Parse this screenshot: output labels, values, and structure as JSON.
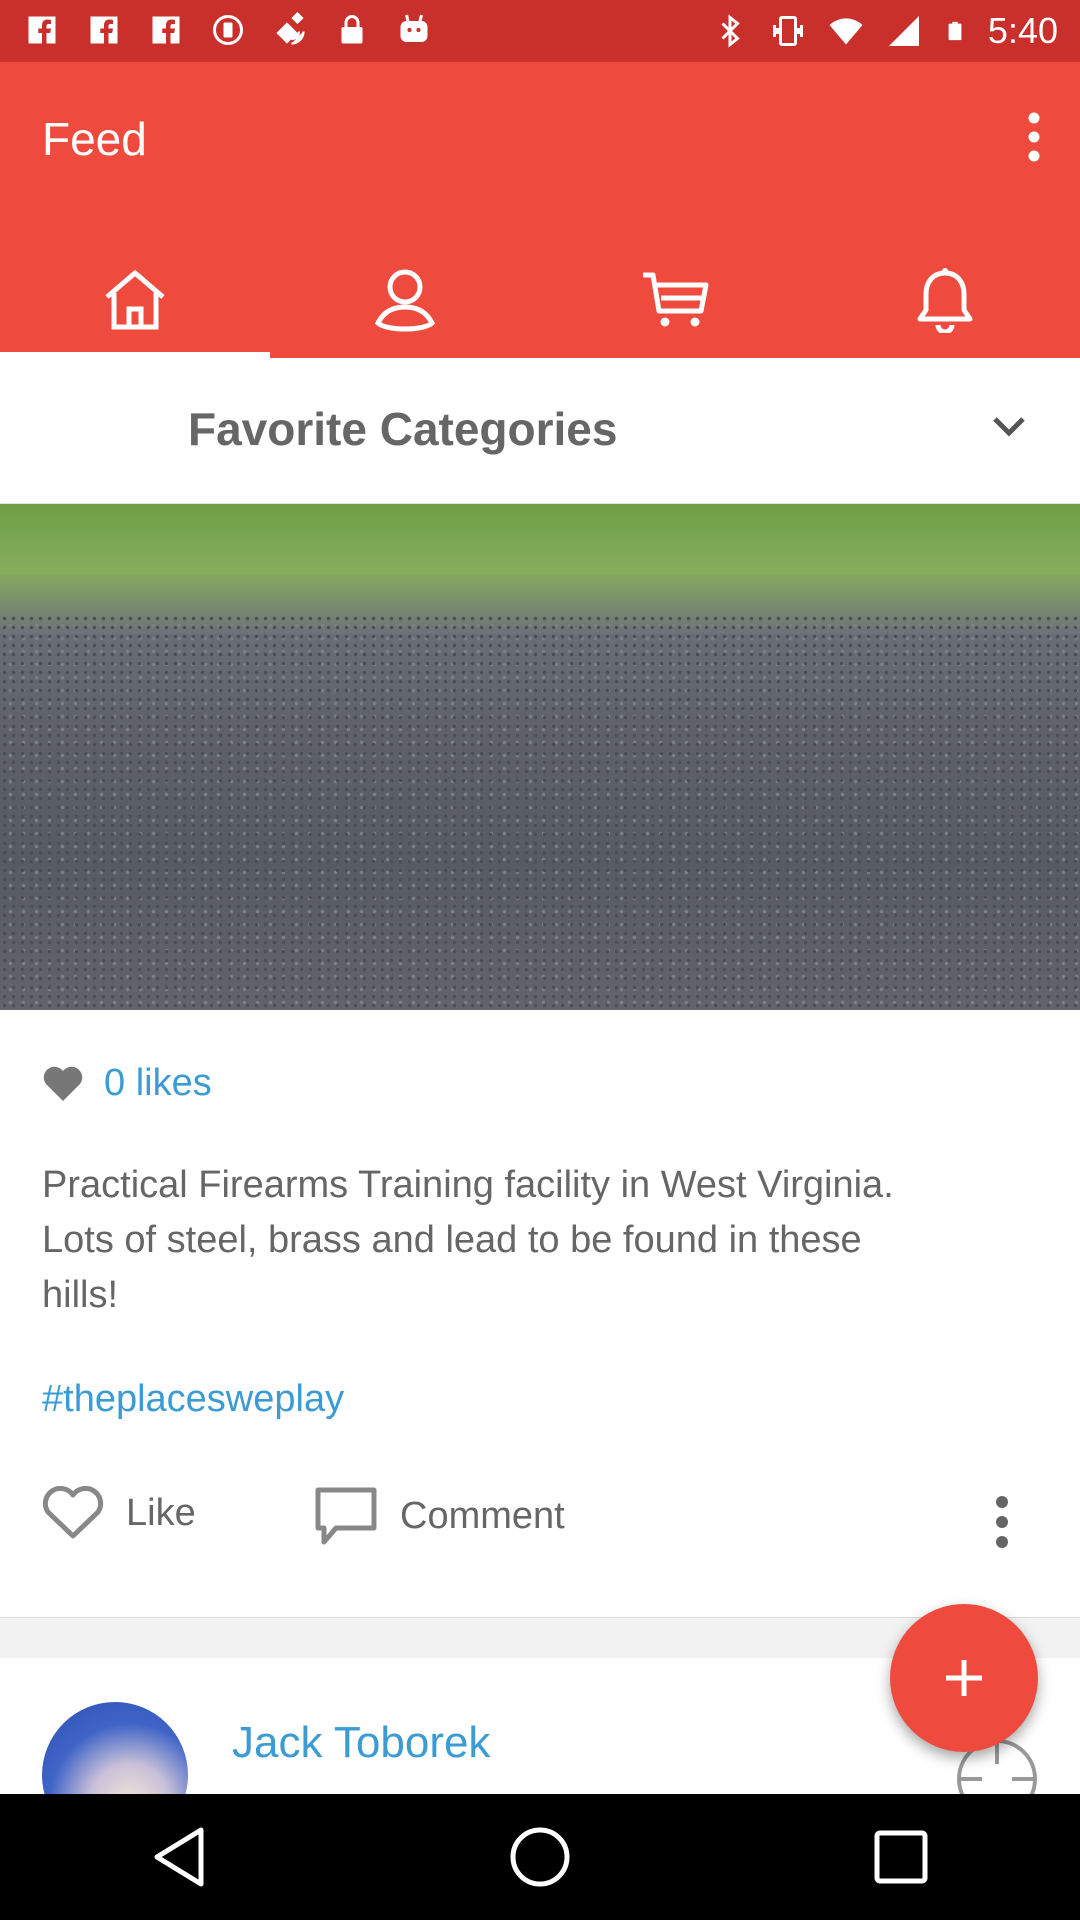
{
  "status_bar": {
    "time": "5:40",
    "left_icons": [
      "facebook-icon",
      "facebook-icon",
      "facebook-icon",
      "record-icon",
      "satellite-icon",
      "lock-icon",
      "android-icon"
    ],
    "right_icons": [
      "bluetooth-icon",
      "vibrate-icon",
      "wifi-icon",
      "signal-icon",
      "battery-icon"
    ]
  },
  "app_bar": {
    "title": "Feed",
    "menu_icon": "more-vert-icon",
    "tabs": [
      {
        "icon": "home-icon",
        "active": true
      },
      {
        "icon": "person-icon",
        "active": false
      },
      {
        "icon": "cart-icon",
        "active": false
      },
      {
        "icon": "bell-icon",
        "active": false
      }
    ]
  },
  "category_selector": {
    "label": "Favorite Categories",
    "icon": "chevron-down-icon"
  },
  "post": {
    "likes_text": "0 likes",
    "text_lines": [
      "Practical Firearms Training facility in West Virginia.",
      "Lots of steel, brass and lead to be found in these",
      "hills!"
    ],
    "hashtag": "#theplacesweplay",
    "like_label": "Like",
    "comment_label": "Comment"
  },
  "next_post": {
    "author": "Jack Toborek"
  },
  "colors": {
    "primary": "#ee4b3e",
    "status_bar": "#c9302c",
    "link": "#3a9bd5",
    "text": "#666666"
  }
}
